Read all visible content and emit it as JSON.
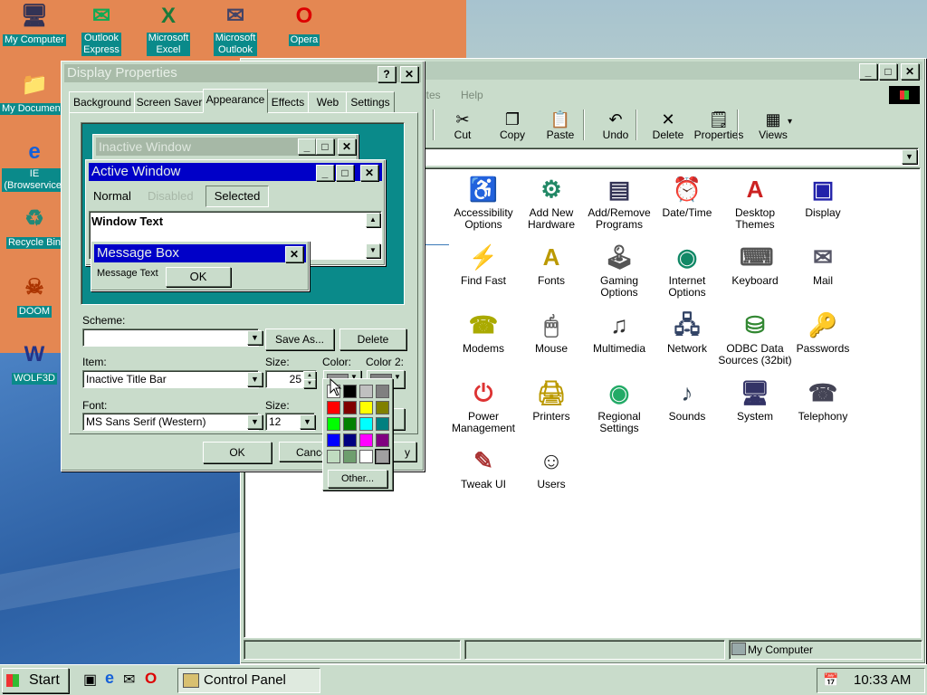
{
  "desktop_icons": [
    {
      "label": "My Computer",
      "icon": "computer-icon"
    },
    {
      "label": "Outlook\nExpress",
      "icon": "outlook-express-icon"
    },
    {
      "label": "Microsoft\nExcel",
      "icon": "excel-icon"
    },
    {
      "label": "Microsoft\nOutlook",
      "icon": "outlook-icon"
    },
    {
      "label": "Opera",
      "icon": "opera-icon"
    },
    {
      "label": "My Documents",
      "icon": "folder-icon"
    },
    {
      "label": "IE\n(Browservice)",
      "icon": "ie-icon"
    },
    {
      "label": "Recycle Bin",
      "icon": "recycle-bin-icon"
    },
    {
      "label": "DOOM",
      "icon": "doom-icon"
    },
    {
      "label": "WOLF3D",
      "icon": "wolf3d-icon"
    }
  ],
  "control_panel": {
    "menu_partial": [
      "ites",
      "Help"
    ],
    "toolbar": [
      {
        "label": "Cut",
        "glyph": "✂"
      },
      {
        "label": "Copy",
        "glyph": "❐"
      },
      {
        "label": "Paste",
        "glyph": "📋"
      },
      {
        "label": "Undo",
        "glyph": "↶"
      },
      {
        "label": "Delete",
        "glyph": "✕"
      },
      {
        "label": "Properties",
        "glyph": "🗒"
      },
      {
        "label": "Views",
        "glyph": "▦"
      }
    ],
    "views_arrow": "▾",
    "items": [
      {
        "label": "Accessibility\nOptions",
        "icon": "accessibility-icon"
      },
      {
        "label": "Add New\nHardware",
        "icon": "add-hardware-icon"
      },
      {
        "label": "Add/Remove\nPrograms",
        "icon": "add-remove-programs-icon"
      },
      {
        "label": "Date/Time",
        "icon": "date-time-icon"
      },
      {
        "label": "Desktop\nThemes",
        "icon": "desktop-themes-icon"
      },
      {
        "label": "Display",
        "icon": "display-icon"
      },
      {
        "label": "Find Fast",
        "icon": "find-fast-icon"
      },
      {
        "label": "Fonts",
        "icon": "fonts-icon"
      },
      {
        "label": "Gaming\nOptions",
        "icon": "gaming-icon"
      },
      {
        "label": "Internet\nOptions",
        "icon": "internet-options-icon"
      },
      {
        "label": "Keyboard",
        "icon": "keyboard-icon"
      },
      {
        "label": "Mail",
        "icon": "mail-icon"
      },
      {
        "label": "Modems",
        "icon": "modem-icon"
      },
      {
        "label": "Mouse",
        "icon": "mouse-icon"
      },
      {
        "label": "Multimedia",
        "icon": "multimedia-icon"
      },
      {
        "label": "Network",
        "icon": "network-icon"
      },
      {
        "label": "ODBC Data\nSources (32bit)",
        "icon": "odbc-icon"
      },
      {
        "label": "Passwords",
        "icon": "passwords-icon"
      },
      {
        "label": "Power\nManagement",
        "icon": "power-icon"
      },
      {
        "label": "Printers",
        "icon": "printer-icon"
      },
      {
        "label": "Regional\nSettings",
        "icon": "globe-icon"
      },
      {
        "label": "Sounds",
        "icon": "sound-icon"
      },
      {
        "label": "System",
        "icon": "system-icon"
      },
      {
        "label": "Telephony",
        "icon": "telephony-icon"
      },
      {
        "label": "Tweak UI",
        "icon": "tweak-ui-icon"
      },
      {
        "label": "Users",
        "icon": "users-icon"
      }
    ],
    "status_right": "My Computer"
  },
  "display_properties": {
    "title": "Display Properties",
    "tabs": [
      "Background",
      "Screen Saver",
      "Appearance",
      "Effects",
      "Web",
      "Settings"
    ],
    "active_tab": "Appearance",
    "preview": {
      "inactive_title": "Inactive Window",
      "active_title": "Active Window",
      "menu_normal": "Normal",
      "menu_disabled": "Disabled",
      "menu_selected": "Selected",
      "window_text": "Window Text",
      "msgbox_title": "Message Box",
      "msgbox_text": "Message Text",
      "msgbox_ok": "OK"
    },
    "scheme_label": "Scheme:",
    "scheme_value": "",
    "save_as": "Save As...",
    "delete": "Delete",
    "item_label": "Item:",
    "item_value": "Inactive Title Bar",
    "size_label": "Size:",
    "size_value": "25",
    "color_label": "Color:",
    "color2_label": "Color 2:",
    "font_label": "Font:",
    "font_value": "MS Sans Serif (Western)",
    "font_size_label": "Size:",
    "font_size_value": "12",
    "ok": "OK",
    "cancel_partial": "Cance",
    "apply_partial": "y"
  },
  "color_picker": {
    "swatches": [
      "#ffffff",
      "#000000",
      "#c0c0c0",
      "#808080",
      "#ff0000",
      "#800000",
      "#ffff00",
      "#808000",
      "#00ff00",
      "#008000",
      "#00ffff",
      "#008080",
      "#0000ff",
      "#000080",
      "#ff00ff",
      "#800080",
      "#c0dcc0",
      "#6e9e6e",
      "#ffffff",
      "#a0a0a0"
    ],
    "other": "Other...",
    "current_color": "#909090",
    "color2_value": "#808080"
  },
  "taskbar": {
    "start": "Start",
    "task": "Control Panel",
    "clock": "10:33 AM"
  },
  "colors": {
    "active_title": "#0000c8",
    "inactive_title": "#a6b8a6",
    "desktop_teal": "#0a8a8a",
    "window_face": "#c9dccb"
  }
}
